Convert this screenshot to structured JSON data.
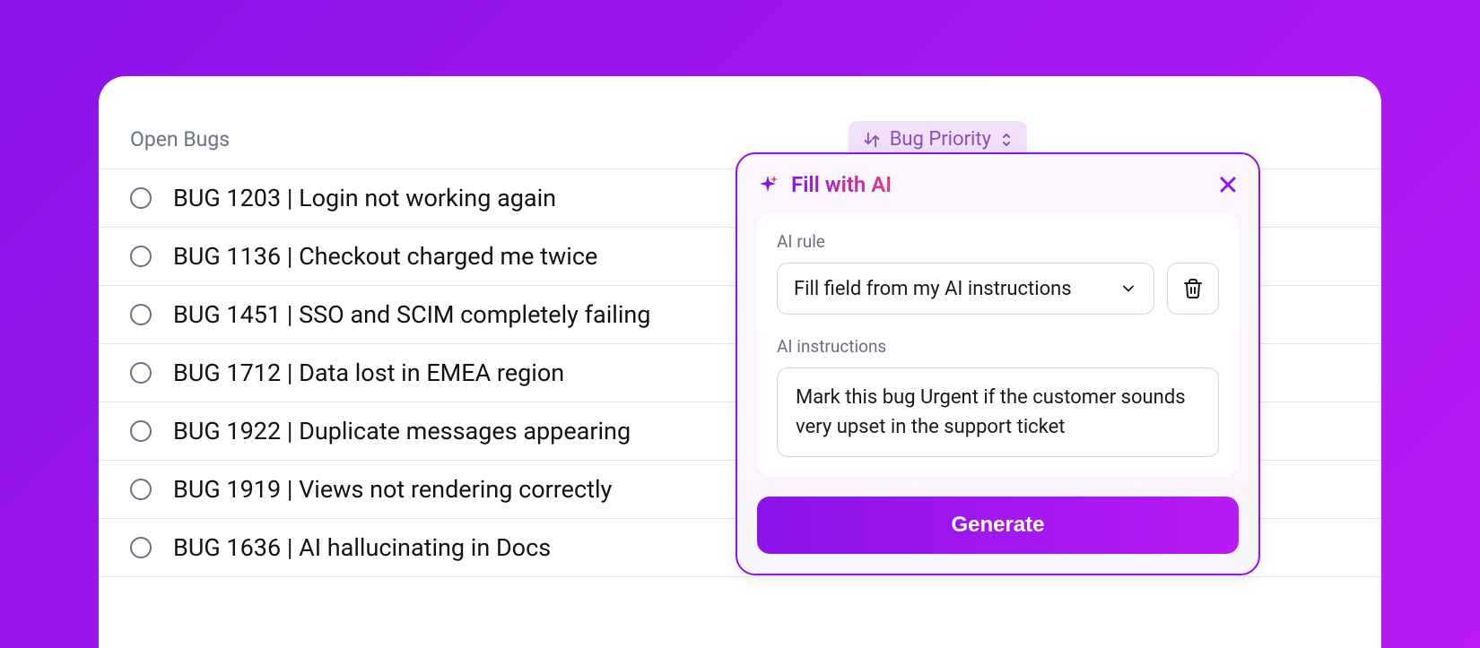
{
  "header": {
    "title": "Open Bugs",
    "priority_chip": "Bug Priority"
  },
  "bugs": [
    {
      "title": "BUG 1203 | Login not working again"
    },
    {
      "title": "BUG 1136 | Checkout charged me twice"
    },
    {
      "title": "BUG 1451 | SSO and SCIM completely failing"
    },
    {
      "title": "BUG 1712 | Data lost in EMEA region"
    },
    {
      "title": "BUG 1922 | Duplicate messages appearing"
    },
    {
      "title": "BUG 1919 | Views not rendering correctly"
    },
    {
      "title": "BUG 1636 | AI hallucinating in Docs"
    }
  ],
  "popover": {
    "title": "Fill with AI",
    "rule_label": "AI rule",
    "rule_value": "Fill field from my AI instructions",
    "instructions_label": "AI instructions",
    "instructions_value": "Mark this bug Urgent if the customer sounds very upset in the support ticket",
    "generate_label": "Generate"
  }
}
